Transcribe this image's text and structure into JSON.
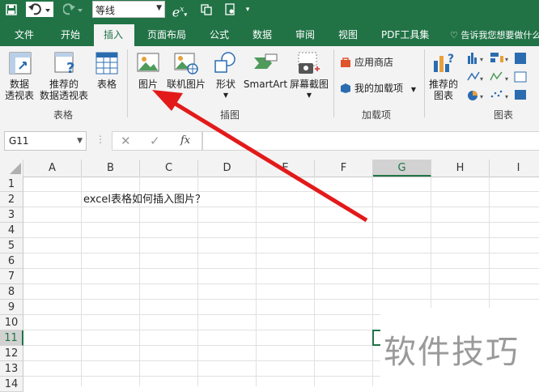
{
  "qat": {
    "font_name": "等线",
    "superscript_label": "e",
    "superscript_exp": "x"
  },
  "tabs": [
    {
      "label": "文件"
    },
    {
      "label": "开始"
    },
    {
      "label": "插入"
    },
    {
      "label": "页面布局"
    },
    {
      "label": "公式"
    },
    {
      "label": "数据"
    },
    {
      "label": "审阅"
    },
    {
      "label": "视图"
    },
    {
      "label": "PDF工具集"
    }
  ],
  "tell_me": "告诉我您想要做什么",
  "ribbon": {
    "pivot_table": [
      "数据",
      "透视表"
    ],
    "recommended_pivot": [
      "推荐的",
      "数据透视表"
    ],
    "table": "表格",
    "group_tables": "表格",
    "picture": "图片",
    "online_picture": "联机图片",
    "shapes": "形状",
    "smartart": "SmartArt",
    "screenshot": "屏幕截图",
    "group_illustrations": "插图",
    "store": "应用商店",
    "my_addins": "我的加载项",
    "group_addins": "加载项",
    "recommended_charts": [
      "推荐的",
      "图表"
    ],
    "group_charts": "图表"
  },
  "formula_bar": {
    "name_box": "G11",
    "fx": "fx",
    "value": ""
  },
  "columns": [
    "A",
    "B",
    "C",
    "D",
    "E",
    "F",
    "G",
    "H",
    "I"
  ],
  "rows": [
    "1",
    "2",
    "3",
    "4",
    "5",
    "6",
    "7",
    "8",
    "9",
    "10",
    "11",
    "12",
    "13",
    "14"
  ],
  "cell_b2": "excel表格如何插入图片？",
  "watermark": "软件技巧",
  "colors": {
    "accent": "#217346",
    "arrow": "#e31a1a"
  }
}
